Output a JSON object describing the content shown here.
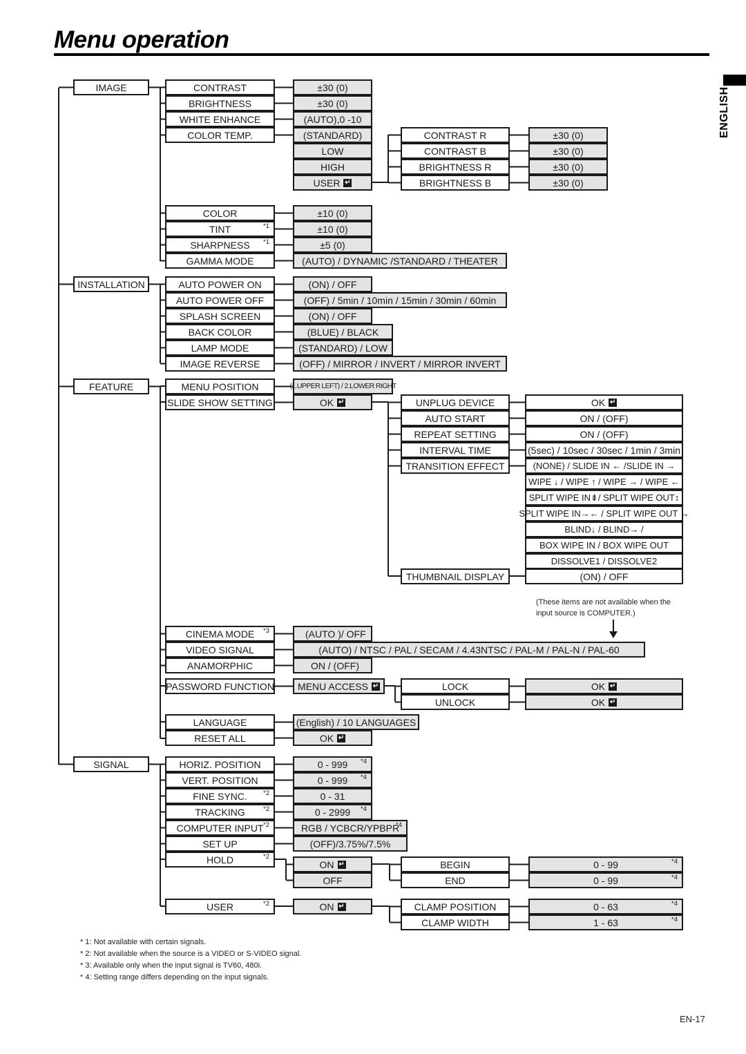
{
  "page": {
    "title": "Menu operation",
    "language_tab": "ENGLISH",
    "page_number": "EN-17",
    "enter_icon": "enter-key-icon",
    "footnotes": [
      "* 1: Not available with certain signals.",
      "* 2: Not available when the source is a VIDEO or S-VIDEO signal.",
      "* 3: Available only when the input signal is TV60, 480i.",
      "* 4: Setting range differs depending on the input signals."
    ],
    "caption_lines": [
      "(These items are not available when the",
      "input source is COMPUTER.)"
    ]
  },
  "menu": {
    "image": {
      "label": "IMAGE",
      "items": [
        {
          "label": "CONTRAST",
          "value": "±30 (0)"
        },
        {
          "label": "BRIGHTNESS",
          "value": "±30 (0)"
        },
        {
          "label": "WHITE ENHANCE",
          "value": "(AUTO),0 -10"
        },
        {
          "label": "COLOR TEMP.",
          "values": [
            "(STANDARD)",
            "LOW",
            "HIGH",
            "USER"
          ]
        },
        {
          "label": "COLOR",
          "value": "±10 (0)"
        },
        {
          "label": "TINT",
          "note": "*1",
          "value": "±10 (0)"
        },
        {
          "label": "SHARPNESS",
          "note": "*1",
          "value": "±5 (0)"
        },
        {
          "label": "GAMMA MODE",
          "value": "(AUTO) / DYNAMIC /STANDARD / THEATER"
        }
      ],
      "user_sub": [
        {
          "label": "CONTRAST R",
          "value": "±30 (0)"
        },
        {
          "label": "CONTRAST B",
          "value": "±30 (0)"
        },
        {
          "label": "BRIGHTNESS R",
          "value": "±30 (0)"
        },
        {
          "label": "BRIGHTNESS B",
          "value": "±30 (0)"
        }
      ]
    },
    "installation": {
      "label": "INSTALLATION",
      "items": [
        {
          "label": "AUTO POWER ON",
          "value": "(ON) / OFF"
        },
        {
          "label": "AUTO POWER OFF",
          "value": "(OFF) / 5min / 10min / 15min / 30min / 60min"
        },
        {
          "label": "SPLASH SCREEN",
          "value": "(ON) / OFF"
        },
        {
          "label": "BACK COLOR",
          "value": "(BLUE) / BLACK"
        },
        {
          "label": "LAMP MODE",
          "value": "(STANDARD) / LOW"
        },
        {
          "label": "IMAGE REVERSE",
          "value": "(OFF) / MIRROR / INVERT / MIRROR INVERT"
        }
      ]
    },
    "feature": {
      "label": "FEATURE",
      "items": [
        {
          "label": "MENU POSITION",
          "value": "(1.UPPER LEFT) / 2.LOWER RIGHT"
        },
        {
          "label": "SLIDE SHOW SETTING",
          "value": "OK"
        },
        {
          "label": "CINEMA MODE",
          "note": "*3",
          "value": "(AUTO )/ OFF"
        },
        {
          "label": "VIDEO SIGNAL",
          "value": "(AUTO) / NTSC / PAL / SECAM / 4.43NTSC / PAL-M / PAL-N / PAL-60"
        },
        {
          "label": "ANAMORPHIC",
          "value": "ON / (OFF)"
        },
        {
          "label": "PASSWORD FUNCTION",
          "value": "MENU ACCESS"
        },
        {
          "label": "LANGUAGE",
          "value": "(English) / 10 LANGUAGES"
        },
        {
          "label": "RESET ALL",
          "value": "OK"
        }
      ],
      "slideshow_sub": [
        {
          "label": "UNPLUG DEVICE",
          "value": "OK"
        },
        {
          "label": "AUTO START",
          "value": "ON / (OFF)"
        },
        {
          "label": "REPEAT SETTING",
          "value": "ON / (OFF)"
        },
        {
          "label": "INTERVAL TIME",
          "value": "(5sec) / 10sec / 30sec / 1min / 3min"
        },
        {
          "label": "TRANSITION EFFECT",
          "values": [
            "(NONE) / SLIDE IN ← /SLIDE IN →",
            "WIPE ↓ / WIPE ↑ / WIPE → / WIPE ←",
            "SPLIT WIPE IN⇟/ SPLIT WIPE OUT↕",
            "SPLIT WIPE IN→← / SPLIT WIPE OUT ↔",
            "BLIND↓ / BLIND→ /",
            "BOX WIPE IN / BOX WIPE OUT",
            "DISSOLVE1 / DISSOLVE2"
          ]
        },
        {
          "label": "THUMBNAIL DISPLAY",
          "value": "(ON) / OFF"
        }
      ],
      "password_sub": [
        {
          "label": "LOCK",
          "value": "OK"
        },
        {
          "label": "UNLOCK",
          "value": "OK"
        }
      ]
    },
    "signal": {
      "label": "SIGNAL",
      "items": [
        {
          "label": "HORIZ. POSITION",
          "value": "0 - 999",
          "value_note": "*4"
        },
        {
          "label": "VERT. POSITION",
          "value": "0 - 999",
          "value_note": "*4"
        },
        {
          "label": "FINE SYNC.",
          "note": "*2",
          "value": "0 - 31"
        },
        {
          "label": "TRACKING",
          "note": "*2",
          "value": "0 - 2999",
          "value_note": "*4"
        },
        {
          "label": "COMPUTER INPUT",
          "note": "*2",
          "value": "RGB / YCBCR/YPBPR",
          "value_note": "*4"
        },
        {
          "label": "SET UP",
          "value": "(OFF)/3.75%/7.5%"
        },
        {
          "label": "HOLD",
          "note": "*2",
          "values": [
            "ON",
            "OFF"
          ]
        },
        {
          "label": "USER",
          "note": "*2",
          "value": "ON"
        }
      ],
      "hold_sub": [
        {
          "label": "BEGIN",
          "value": "0 - 99",
          "value_note": "*4"
        },
        {
          "label": "END",
          "value": "0 - 99",
          "value_note": "*4"
        }
      ],
      "user_sub": [
        {
          "label": "CLAMP POSITION",
          "value": "0 - 63",
          "value_note": "*4"
        },
        {
          "label": "CLAMP WIDTH",
          "value": "1 - 63",
          "value_note": "*4"
        }
      ]
    }
  }
}
